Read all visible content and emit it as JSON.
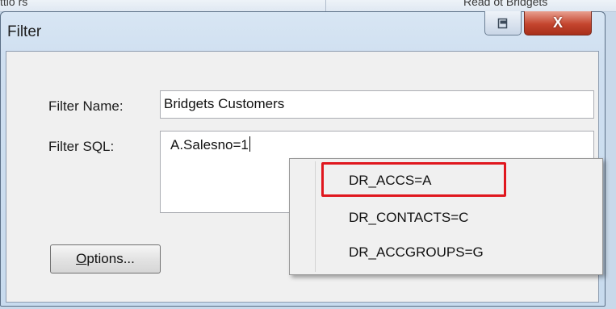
{
  "background": {
    "left_text": "ttlo rs",
    "right_text": "Read ot Bridgets"
  },
  "window": {
    "title": "Filter",
    "restore_icon": "restore-icon",
    "close_glyph": "X"
  },
  "form": {
    "name_label": "Filter Name:",
    "name_value": "Bridgets Customers",
    "sql_label": "Filter SQL:",
    "sql_value": "A.Salesno=1"
  },
  "buttons": {
    "options_label_underlined": "O",
    "options_label_rest": "ptions..."
  },
  "autocomplete": {
    "items": [
      "DR_ACCS=A",
      "DR_CONTACTS=C",
      "DR_ACCGROUPS=G"
    ],
    "highlight_color": "#e0171e"
  }
}
